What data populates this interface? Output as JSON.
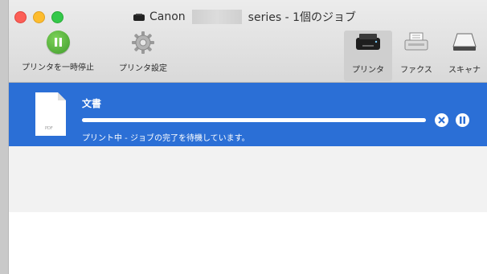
{
  "window": {
    "title_prefix": "Canon",
    "title_suffix": "series - 1個のジョブ"
  },
  "toolbar": {
    "pause_printer_label": "プリンタを一時停止",
    "printer_setup_label": "プリンタ設定",
    "tabs": [
      {
        "label": "プリンタ",
        "selected": true,
        "icon": "printer-icon"
      },
      {
        "label": "ファクス",
        "selected": false,
        "icon": "fax-icon"
      },
      {
        "label": "スキャナ",
        "selected": false,
        "icon": "scanner-icon"
      }
    ]
  },
  "job": {
    "name": "文書",
    "status": "プリント中 - ジョブの完了を待機しています。",
    "progress": 1.0,
    "thumbnail_text": "PDF"
  },
  "colors": {
    "selection": "#2b6fd6",
    "pause_green": "#4caf35"
  }
}
